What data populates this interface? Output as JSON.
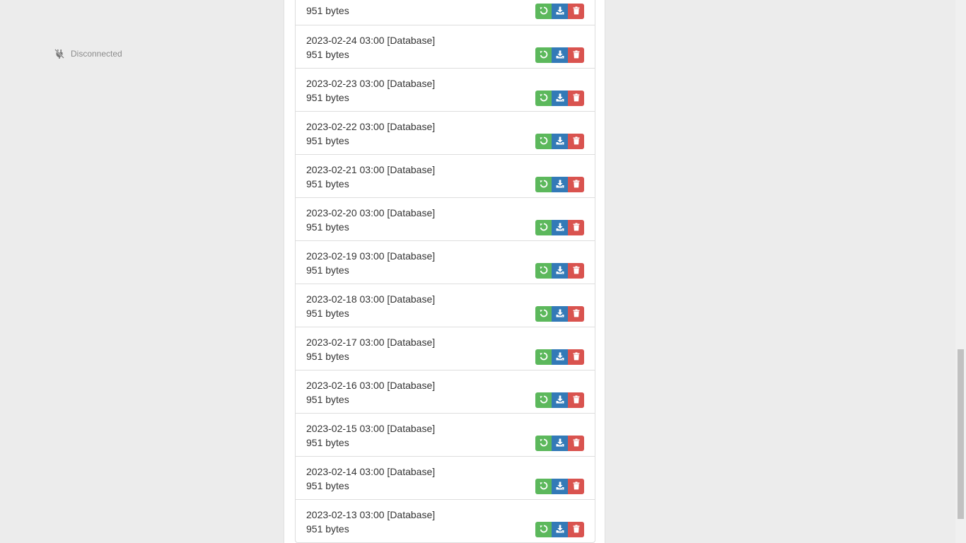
{
  "status": {
    "icon": "plug-disconnected-icon",
    "label": "Disconnected"
  },
  "backups": [
    {
      "title": "",
      "size": "951 bytes"
    },
    {
      "title": "2023-02-24 03:00 [Database]",
      "size": "951 bytes"
    },
    {
      "title": "2023-02-23 03:00 [Database]",
      "size": "951 bytes"
    },
    {
      "title": "2023-02-22 03:00 [Database]",
      "size": "951 bytes"
    },
    {
      "title": "2023-02-21 03:00 [Database]",
      "size": "951 bytes"
    },
    {
      "title": "2023-02-20 03:00 [Database]",
      "size": "951 bytes"
    },
    {
      "title": "2023-02-19 03:00 [Database]",
      "size": "951 bytes"
    },
    {
      "title": "2023-02-18 03:00 [Database]",
      "size": "951 bytes"
    },
    {
      "title": "2023-02-17 03:00 [Database]",
      "size": "951 bytes"
    },
    {
      "title": "2023-02-16 03:00 [Database]",
      "size": "951 bytes"
    },
    {
      "title": "2023-02-15 03:00 [Database]",
      "size": "951 bytes"
    },
    {
      "title": "2023-02-14 03:00 [Database]",
      "size": "951 bytes"
    },
    {
      "title": "2023-02-13 03:00 [Database]",
      "size": "951 bytes"
    }
  ],
  "actions": {
    "restore": {
      "icon": "restore-icon",
      "color": "#5cb85c"
    },
    "download": {
      "icon": "download-icon",
      "color": "#337ab7"
    },
    "delete": {
      "icon": "trash-icon",
      "color": "#d9534f"
    }
  }
}
